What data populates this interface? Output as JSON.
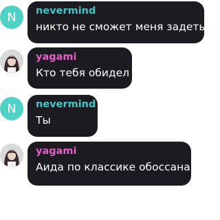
{
  "messages": [
    {
      "author": "nevermind",
      "author_color": "#3ec9c6",
      "avatar_letter": "N",
      "avatar_color": "#4fd1c5",
      "text": "никто не сможет меня задеть"
    },
    {
      "author": "yagami",
      "author_color": "#e35fc8",
      "avatar_icon": "user-photo",
      "text": "Кто тебя обидел"
    },
    {
      "author": "nevermind",
      "author_color": "#3ec9c6",
      "avatar_letter": "N",
      "avatar_color": "#4fd1c5",
      "text": "Ты"
    },
    {
      "author": "yagami",
      "author_color": "#e35fc8",
      "avatar_icon": "user-photo",
      "text": "Аида по классике обоссана"
    }
  ],
  "colors": {
    "bubble_background": "#1c1b22",
    "message_text": "#ffffff"
  }
}
